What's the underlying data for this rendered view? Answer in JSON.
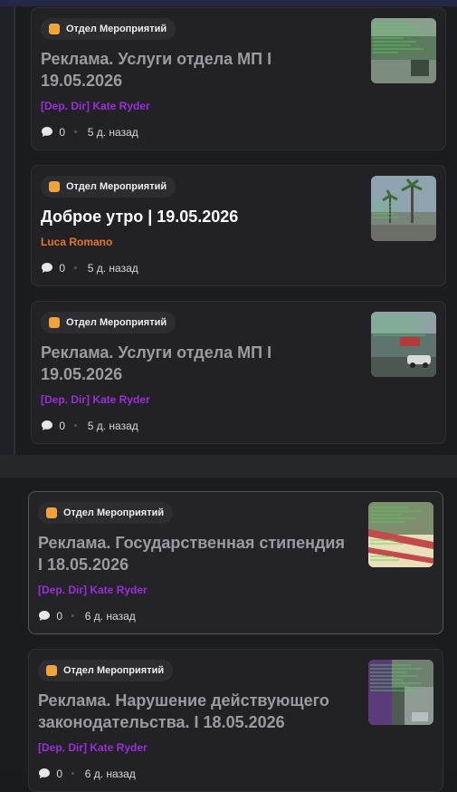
{
  "posts": [
    {
      "category": "Отдел Мероприятий",
      "title": "Реклама. Услуги отдела МП I 19.05.2026",
      "author": "[Dep. Dir] Kate Ryder",
      "comments": "0",
      "time": "5 д. назад"
    },
    {
      "category": "Отдел Мероприятий",
      "title": "Доброе утро | 19.05.2026",
      "author": "Luca Romano",
      "comments": "0",
      "time": "5 д. назад"
    },
    {
      "category": "Отдел Мероприятий",
      "title": "Реклама. Услуги отдела МП I 19.05.2026",
      "author": "[Dep. Dir] Kate Ryder",
      "comments": "0",
      "time": "5 д. назад"
    },
    {
      "category": "Отдел Мероприятий",
      "title": "Реклама. Государственная стипендия I 18.05.2026",
      "author": "[Dep. Dir] Kate Ryder",
      "comments": "0",
      "time": "6 д. назад"
    },
    {
      "category": "Отдел Мероприятий",
      "title": "Реклама. Нарушение действующего законодательства. I 18.05.2026",
      "author": "[Dep. Dir] Kate Ryder",
      "comments": "0",
      "time": "6 д. назад"
    }
  ],
  "colors": {
    "category_accent": "#f0a33a",
    "author_staff": "#9b2fd6",
    "author_user": "#e4762a",
    "title_read": "#9a9aa0",
    "title_unread": "#ffffff"
  },
  "icons": {
    "category": "category-square-icon",
    "comments": "speech-bubble-icon"
  }
}
